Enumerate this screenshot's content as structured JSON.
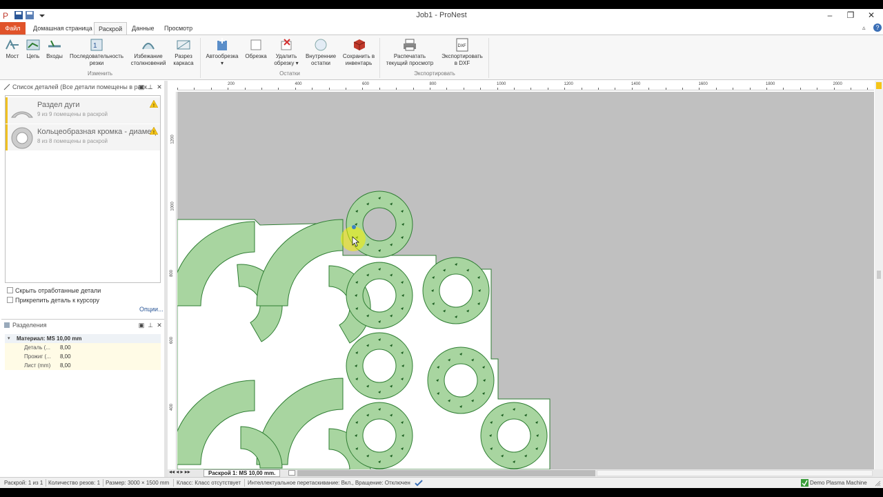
{
  "window": {
    "title": "Job1 - ProNest"
  },
  "tabs": [
    "Файл",
    "Домашная страница",
    "Раскрой",
    "Данные",
    "Просмотр"
  ],
  "ribbon": {
    "groups": [
      {
        "label": "Изменить",
        "buttons": [
          "Мост",
          "Цепь",
          "Входы",
          "Последовательность резки",
          "Избежание столкновений",
          "Разрез каркаса"
        ]
      },
      {
        "label": "Остатки",
        "buttons": [
          "Автообрезка",
          "Обрезка",
          "Удалить обрезку",
          "Внутренние остатки",
          "Сохранить в инвентарь"
        ]
      },
      {
        "label": "Экспортировать",
        "buttons": [
          "Распечатать текущий просмотр",
          "Экспортировать в DXF"
        ]
      }
    ]
  },
  "parts_panel": {
    "title": "Список деталей  (Все детали помещены в раск...",
    "items": [
      {
        "name": "Раздел дуги",
        "status": "9 из 9 помещены в раскрой"
      },
      {
        "name": "Кольцеобразная кромка - диаметр",
        "status": "8 из 8 помещены в раскрой"
      }
    ],
    "checkboxes": [
      "Скрыть отработанные детали",
      "Прикрепить деталь к курсору"
    ],
    "options_link": "Опции..."
  },
  "separations_panel": {
    "title": "Разделения",
    "material": "Материал: MS 10,00 mm",
    "rows": [
      {
        "key": "Деталь (...",
        "value": "8,00"
      },
      {
        "key": "Прожиг (...",
        "value": "8,00"
      },
      {
        "key": "Лист (mm)",
        "value": "8,00"
      }
    ]
  },
  "rulers": {
    "h_ticks": [
      "200",
      "400",
      "600",
      "800",
      "1000",
      "1200",
      "1400",
      "1600",
      "1800",
      "2000"
    ],
    "v_ticks": [
      "1200",
      "1000",
      "800",
      "600",
      "400"
    ]
  },
  "sheet_tab": "Раскрой 1: MS 10,00 mm.",
  "status": {
    "nest": "Раскрой: 1 из 1",
    "cuts": "Количество резов: 1",
    "size": "Размер: 3000 × 1500 mm",
    "class": "Класс: Класс отсутствует",
    "smart": "Интеллектуальное перетаскивание: Вкл., Вращение: Отключен",
    "machine": "Demo Plasma Machine"
  },
  "colors": {
    "part_fill": "#a8d5a0",
    "part_stroke": "#2e7d32",
    "sheet": "#c0c0c0",
    "file_tab": "#e0532a"
  }
}
